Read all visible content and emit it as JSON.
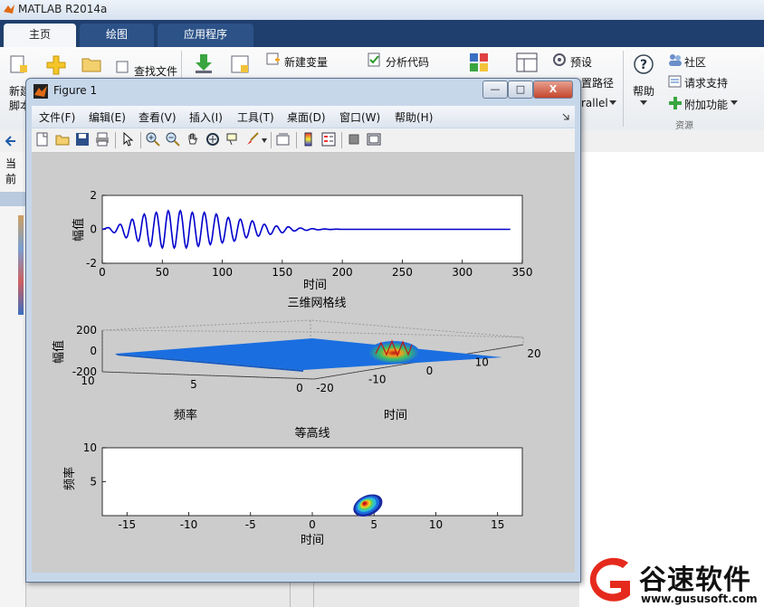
{
  "desktop": {
    "title": "MATLAB R2014a",
    "tabs": [
      "主页",
      "绘图",
      "应用程序"
    ],
    "ribbon": {
      "new_script": "新建",
      "new_script_sub": "脚本",
      "find_files": "查找文件",
      "new_variable": "新建变量",
      "analyze_code": "分析代码",
      "preferences": "预设",
      "set_path": "置路径",
      "parallel": "rallel",
      "help": "帮助",
      "community": "社区",
      "request_support": "请求支持",
      "addons": "附加功能",
      "resources": "资源"
    },
    "current_folder_label": "当前"
  },
  "figure": {
    "title": "Figure 1",
    "menu": [
      "文件(F)",
      "编辑(E)",
      "查看(V)",
      "插入(I)",
      "工具(T)",
      "桌面(D)",
      "窗口(W)",
      "帮助(H)"
    ],
    "window_buttons": {
      "minimize": "—",
      "maximize": "□",
      "close": "X"
    }
  },
  "chart_data": [
    {
      "type": "line",
      "title": "",
      "xlabel": "时间",
      "ylabel": "幅值",
      "xlim": [
        0,
        350
      ],
      "ylim": [
        -2,
        2
      ],
      "xticks": [
        0,
        50,
        100,
        150,
        200,
        250,
        300,
        350
      ],
      "yticks": [
        -2,
        0,
        2
      ],
      "series": [
        {
          "color": "#0000cc",
          "x": [
            0,
            5,
            10,
            15,
            20,
            25,
            30,
            35,
            40,
            45,
            50,
            55,
            60,
            65,
            70,
            75,
            80,
            85,
            90,
            95,
            100,
            105,
            110,
            115,
            120,
            125,
            130,
            135,
            140,
            145,
            150,
            155,
            160,
            165,
            170,
            175,
            180,
            185,
            190,
            195,
            200,
            210,
            220,
            230,
            240,
            250,
            260,
            270,
            280,
            290,
            300,
            310,
            320,
            330,
            340
          ],
          "y": [
            0,
            0.1,
            -0.2,
            0.3,
            -0.5,
            0.6,
            -0.7,
            0.9,
            -1.0,
            1.0,
            -1.1,
            1.1,
            -1.1,
            1.1,
            -1.1,
            1.0,
            -1.0,
            1.0,
            -0.9,
            0.9,
            -0.8,
            0.7,
            -0.7,
            0.6,
            -0.5,
            0.5,
            -0.4,
            0.3,
            -0.3,
            0.2,
            -0.2,
            0.15,
            -0.1,
            0.08,
            -0.06,
            0.04,
            -0.03,
            0.02,
            -0.01,
            0.01,
            0,
            0,
            0,
            0,
            0,
            0,
            0,
            0,
            0,
            0,
            0,
            0,
            0,
            0,
            0
          ]
        }
      ]
    },
    {
      "type": "surface",
      "title": "三维网格线",
      "xlabel": "时间",
      "ylabel": "频率",
      "zlabel": "幅值",
      "zticks": [
        -200,
        0,
        200
      ],
      "yticks": [
        0,
        5,
        10
      ],
      "xticks": [
        -20,
        -10,
        0,
        10,
        20
      ]
    },
    {
      "type": "contour",
      "title": "等高线",
      "xlabel": "时间",
      "ylabel": "频率",
      "xlim": [
        -17,
        17
      ],
      "ylim": [
        0,
        10
      ],
      "xticks": [
        -15,
        -10,
        -5,
        0,
        5,
        10,
        15
      ],
      "yticks": [
        5,
        10
      ],
      "peak": {
        "x": 4.5,
        "y": 1.5
      }
    }
  ],
  "watermark": {
    "brand": "谷速软件",
    "url": "www.gususoft.com"
  },
  "colors": {
    "ribbon_tab_bg": "#1f3f6e",
    "plot_line": "#0000cc",
    "watermark_red": "#e52a1d"
  }
}
